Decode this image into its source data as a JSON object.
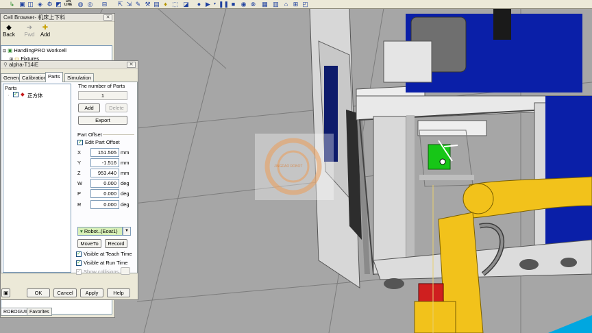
{
  "viewport": {
    "watermark": "JINGDAO ROBOT"
  },
  "toolbar": {
    "icons": [
      "play-icon",
      "pause-icon",
      "stop-icon"
    ],
    "online_label_1": "ON",
    "online_label_2": "LINE"
  },
  "cell_browser": {
    "title": "Cell Browser- 机床上下料",
    "back_label": "Back",
    "fwd_label": "Fwd",
    "add_label": "Add",
    "tree": {
      "root": "HandlingPRO Workcell",
      "child": "Fixtures"
    },
    "bottom_tabs": [
      "ROBOGUIDE",
      "Favorites"
    ]
  },
  "dialog": {
    "title": "alpha-T14iE",
    "tabs": [
      "General",
      "Calibration",
      "Parts",
      "Simulation"
    ],
    "active_tab": "Parts",
    "parts_list_header": "Parts",
    "parts": [
      {
        "name": "正方体",
        "checked": true
      }
    ],
    "number_of_parts_label": "The number of Parts",
    "number_of_parts": "1",
    "add_label": "Add",
    "delete_label": "Delete",
    "export_label": "Export",
    "part_offset_label": "Part Offset",
    "edit_part_offset_label": "Edit Part Offset",
    "offsets": [
      {
        "axis": "X",
        "value": "151.505",
        "unit": "mm"
      },
      {
        "axis": "Y",
        "value": "-1.516",
        "unit": "mm"
      },
      {
        "axis": "Z",
        "value": "953.440",
        "unit": "mm"
      },
      {
        "axis": "W",
        "value": "0.000",
        "unit": "deg"
      },
      {
        "axis": "P",
        "value": "0.000",
        "unit": "deg"
      },
      {
        "axis": "R",
        "value": "0.000",
        "unit": "deg"
      }
    ],
    "robot_selector": "Robot..(Eoat1)",
    "moveto_label": "MoveTo",
    "record_label": "Record",
    "visible_teach_label": "Visible at Teach Time",
    "visible_run_label": "Visible at Run Time",
    "show_collisions_label": "Show collisions",
    "ok_label": "OK",
    "cancel_label": "Cancel",
    "apply_label": "Apply",
    "help_label": "Help"
  }
}
